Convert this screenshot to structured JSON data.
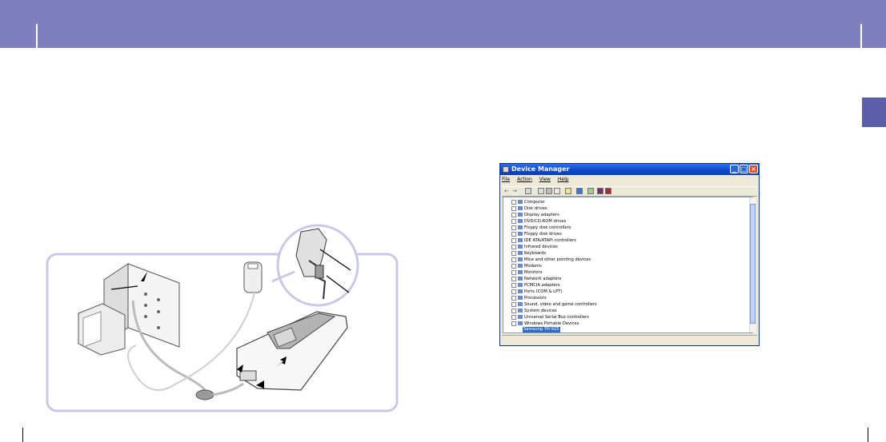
{
  "header": {
    "color": "#7f7fbd"
  },
  "side_tab": {
    "color": "#5b5fa8"
  },
  "device_manager": {
    "title": "Device Manager",
    "menu": [
      "File",
      "Action",
      "View",
      "Help"
    ],
    "tree_items": [
      "Computer",
      "Disk drives",
      "Display adapters",
      "DVD/CD-ROM drives",
      "Floppy disk controllers",
      "Floppy disk drives",
      "IDE ATA/ATAPI controllers",
      "Infrared devices",
      "Keyboards",
      "Mice and other pointing devices",
      "Modems",
      "Monitors",
      "Network adapters",
      "PCMCIA adapters",
      "Ports (COM & LPT)",
      "Processors",
      "Sound, video and game controllers",
      "System devices",
      "Universal Serial Bus controllers",
      "Windows Portable Devices"
    ],
    "selected_child": "Samsung YH-925"
  },
  "icons": [
    "device-manager-icon",
    "minimize-icon",
    "maximize-icon",
    "close-icon",
    "back-icon",
    "forward-icon"
  ]
}
